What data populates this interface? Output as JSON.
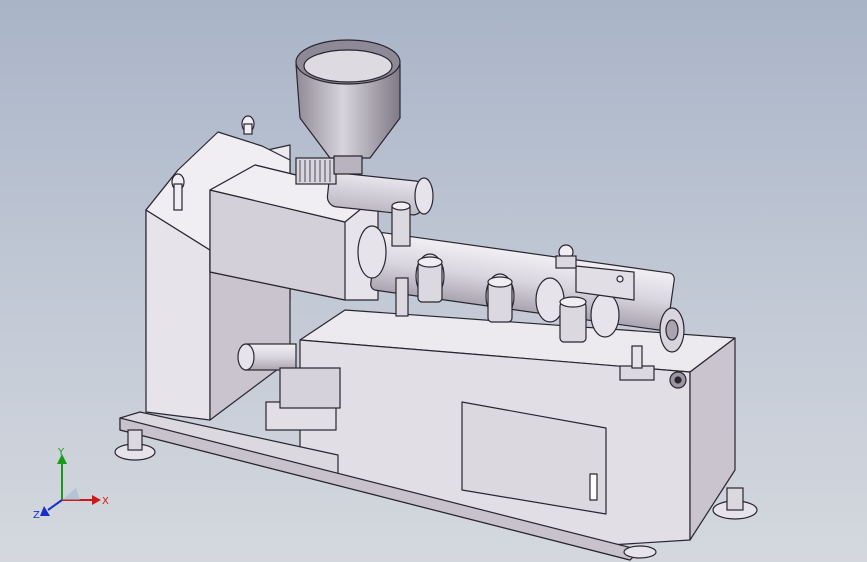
{
  "viewport": {
    "background_top": "#a9b4c7",
    "background_bottom": "#d4d8de",
    "model_fill": "#e6e3ea",
    "model_shade": "#c7c2cc",
    "model_dark": "#9b96a1",
    "edge_color": "#2a2630"
  },
  "triad": {
    "x_label": "X",
    "y_label": "Y",
    "z_label": "Z",
    "x_color": "#d01818",
    "y_color": "#1a9a1a",
    "z_color": "#1830c8"
  }
}
